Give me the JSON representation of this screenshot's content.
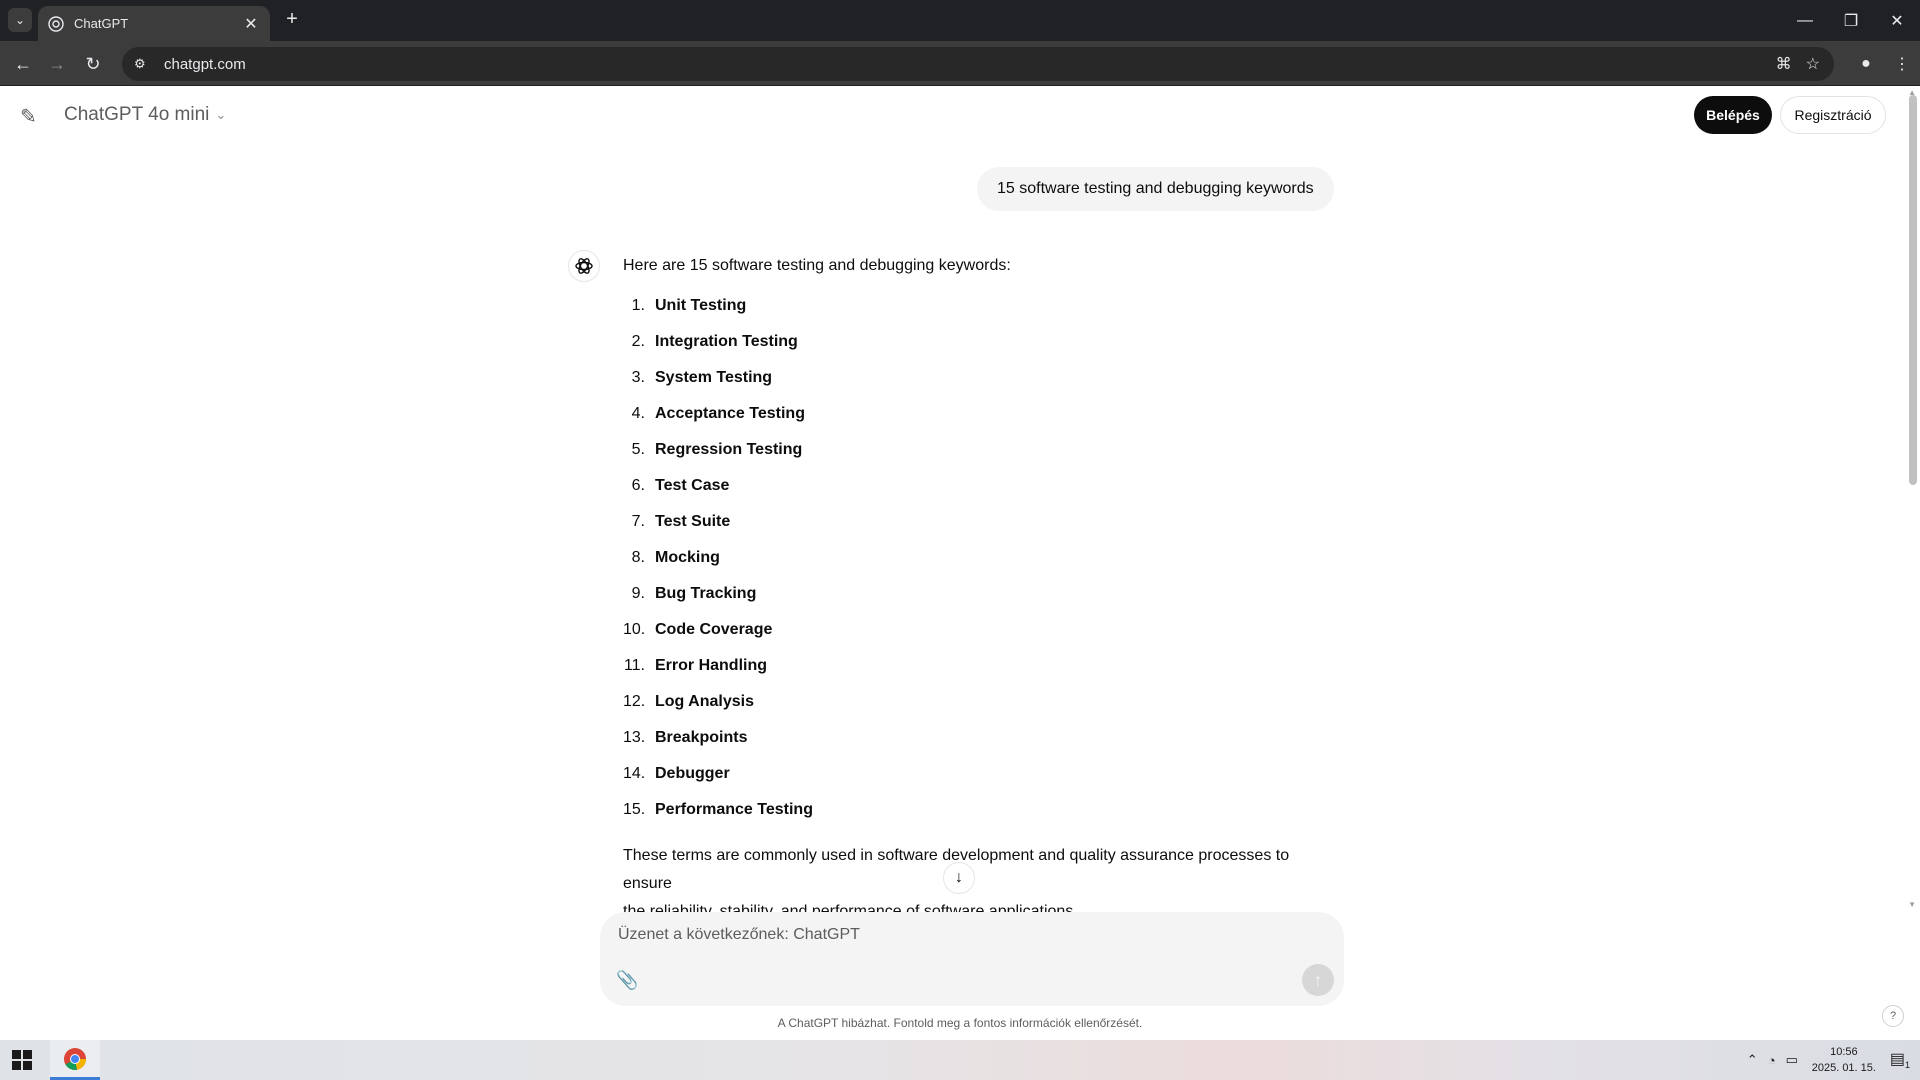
{
  "browser": {
    "tab_title": "ChatGPT",
    "url": "chatgpt.com",
    "icons": {
      "tab_search": "chevron-down-icon",
      "new_tab": "plus-icon",
      "back": "arrow-left-icon",
      "forward": "arrow-right-icon",
      "reload": "reload-icon",
      "site_info": "tune-icon",
      "translate": "translate-icon",
      "bookmark": "star-icon",
      "profile": "person-icon",
      "menu": "kebab-icon"
    }
  },
  "header": {
    "model_name": "ChatGPT 4o mini",
    "login_label": "Belépés",
    "register_label": "Regisztráció"
  },
  "conversation": {
    "user_message": "15 software testing and debugging keywords",
    "assistant": {
      "intro": "Here are 15 software testing and debugging keywords:",
      "items": [
        {
          "num": "1.",
          "text": "Unit Testing"
        },
        {
          "num": "2.",
          "text": "Integration Testing"
        },
        {
          "num": "3.",
          "text": "System Testing"
        },
        {
          "num": "4.",
          "text": "Acceptance Testing"
        },
        {
          "num": "5.",
          "text": "Regression Testing"
        },
        {
          "num": "6.",
          "text": "Test Case"
        },
        {
          "num": "7.",
          "text": "Test Suite"
        },
        {
          "num": "8.",
          "text": "Mocking"
        },
        {
          "num": "9.",
          "text": "Bug Tracking"
        },
        {
          "num": "10.",
          "text": "Code Coverage"
        },
        {
          "num": "11.",
          "text": "Error Handling"
        },
        {
          "num": "12.",
          "text": "Log Analysis"
        },
        {
          "num": "13.",
          "text": "Breakpoints"
        },
        {
          "num": "14.",
          "text": "Debugger"
        },
        {
          "num": "15.",
          "text": "Performance Testing"
        }
      ],
      "outro_line1": "These terms are commonly used in software development and quality assurance processes to ensure",
      "outro_line2": "the reliability, stability, and performance of software applications."
    }
  },
  "composer": {
    "placeholder": "Üzenet a következőnek: ChatGPT",
    "disclaimer": "A ChatGPT hibázhat. Fontold meg a fontos információk ellenőrzését."
  },
  "taskbar": {
    "time": "10:56",
    "date": "2025. 01. 15.",
    "notifications": "1"
  },
  "colors": {
    "login_bg": "#0d0d0d",
    "user_bubble": "#f4f4f4",
    "chrome_dark": "#202124"
  }
}
